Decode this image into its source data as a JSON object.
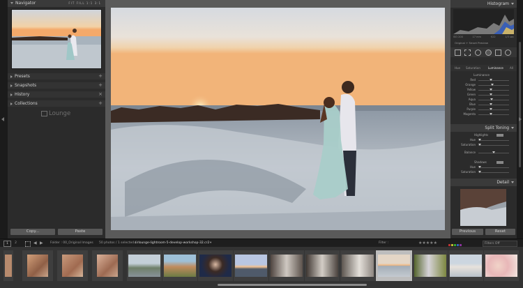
{
  "left_panel": {
    "navigator": {
      "title": "Navigator",
      "zoom_options": [
        "FIT",
        "FILL",
        "1:1",
        "3:1"
      ]
    },
    "sections": [
      {
        "title": "Presets"
      },
      {
        "title": "Snapshots"
      },
      {
        "title": "History"
      },
      {
        "title": "Collections"
      }
    ],
    "logo_text": "Lounge",
    "copy_label": "Copy...",
    "paste_label": "Paste"
  },
  "right_panel": {
    "histogram_title": "Histogram",
    "histogram_info": [
      "ISO 200",
      "17 mm",
      "f/22",
      "1/3 sec"
    ],
    "preview_label": "Original + Smart Preview",
    "hsl_tabs": [
      "Hue",
      "Saturation",
      "Luminance",
      "All"
    ],
    "luminance_title": "Luminance",
    "luminance_sliders": [
      "Red",
      "Orange",
      "Yellow",
      "Green",
      "Aqua",
      "Blue",
      "Purple",
      "Magenta"
    ],
    "split_toning_title": "Split Toning",
    "highlights_label": "Highlights",
    "split_highlight_sliders": [
      "Hue",
      "Saturation"
    ],
    "balance_label": "Balance",
    "shadows_label": "Shadows",
    "split_shadow_sliders": [
      "Hue",
      "Saturation"
    ],
    "detail_title": "Detail",
    "previous_label": "Previous",
    "reset_label": "Reset"
  },
  "toolbar": {
    "page_1": "1",
    "page_2": "2",
    "folder_text": "Folder : 00_Original Images",
    "count_text": "50 photos / 1 selected /",
    "filename": "sirlounge-lightroom-5-develop-workshop-32.cr2",
    "filter_label": "Filter :",
    "filters_off": "Filters Off"
  },
  "filmstrip": {
    "thumbs": [
      "canyon",
      "canyon",
      "canyon",
      "ocean-rocks",
      "cliff",
      "portrait",
      "sunset-beach",
      "couple-rocks",
      "couple-rocks",
      "couple-waves",
      "couple-beach",
      "couple-grass",
      "couple-beach",
      "baby"
    ],
    "selected_index": 10
  },
  "colors": {
    "accent": "#d9d9d9",
    "panel": "#2b2b2b",
    "panel_header": "#3a3a3a"
  }
}
